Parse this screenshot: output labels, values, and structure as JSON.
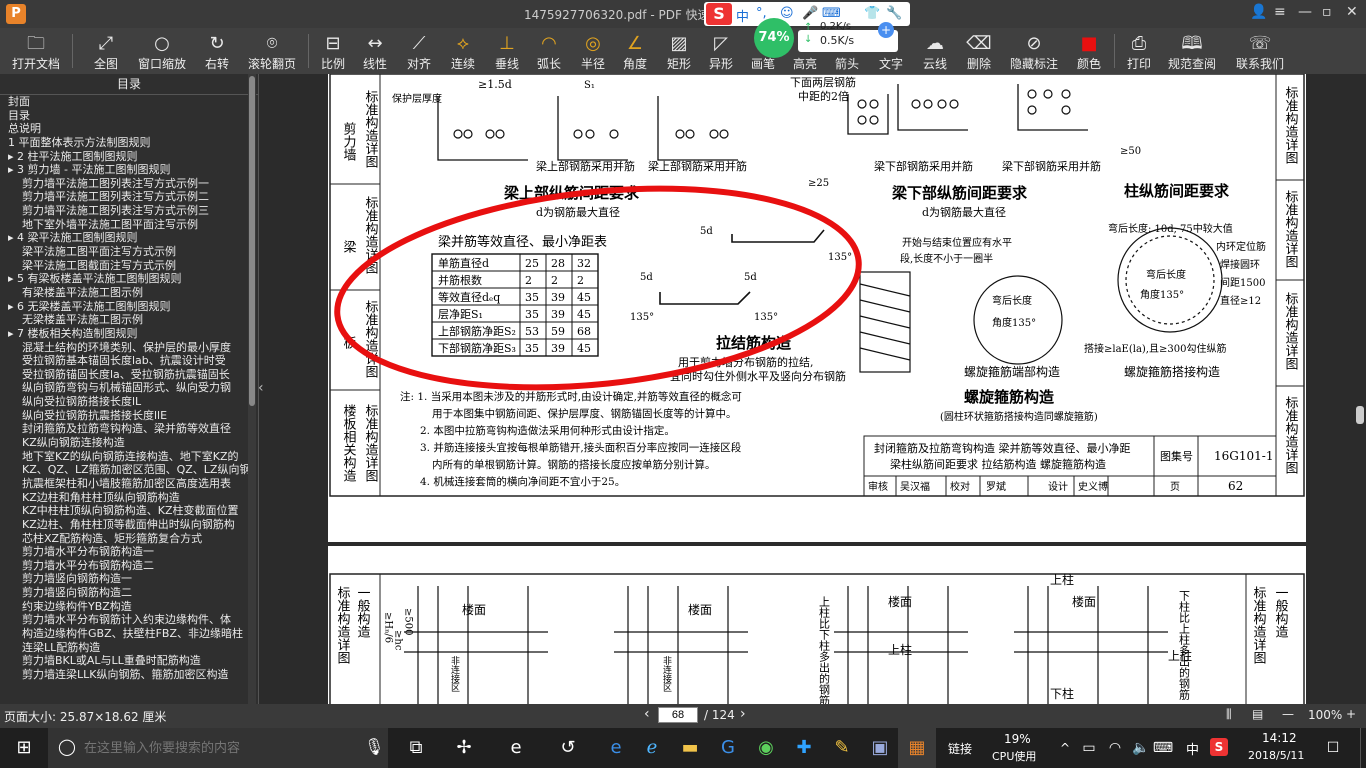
{
  "window": {
    "title": "1475927706320.pdf - PDF 快速看",
    "app_icon": "P"
  },
  "ime": {
    "logo": "S",
    "items": [
      "中",
      "°,",
      "☺",
      "🎤",
      "⌨",
      "👕",
      "🔧"
    ]
  },
  "network": {
    "percent": "74%",
    "up": "0.2K/s",
    "down": "0.5K/s"
  },
  "toolbar": [
    {
      "label": "打开文档",
      "icon": "folder-icon"
    },
    {
      "label": "全图",
      "icon": "fit-icon"
    },
    {
      "label": "窗口缩放",
      "icon": "zoom-icon"
    },
    {
      "label": "右转",
      "icon": "rotate-icon"
    },
    {
      "label": "滚轮翻页",
      "icon": "mouse-icon"
    },
    {
      "label": "比例",
      "icon": "scale-icon"
    },
    {
      "label": "线性",
      "icon": "linear-icon"
    },
    {
      "label": "对齐",
      "icon": "align-icon"
    },
    {
      "label": "连续",
      "icon": "continuous-icon"
    },
    {
      "label": "垂线",
      "icon": "perpendicular-icon"
    },
    {
      "label": "弧长",
      "icon": "arc-icon"
    },
    {
      "label": "半径",
      "icon": "radius-icon"
    },
    {
      "label": "角度",
      "icon": "angle-icon"
    },
    {
      "label": "矩形",
      "icon": "rect-icon"
    },
    {
      "label": "异形",
      "icon": "shape-icon"
    },
    {
      "label": "画笔",
      "icon": "pen-icon"
    },
    {
      "label": "高亮",
      "icon": "highlight-icon"
    },
    {
      "label": "箭头",
      "icon": "arrow-icon"
    },
    {
      "label": "文字",
      "icon": "text-icon"
    },
    {
      "label": "云线",
      "icon": "cloud-icon"
    },
    {
      "label": "删除",
      "icon": "eraser-icon"
    },
    {
      "label": "隐藏标注",
      "icon": "hide-icon"
    },
    {
      "label": "颜色",
      "icon": "color-icon"
    },
    {
      "label": "打印",
      "icon": "print-icon"
    },
    {
      "label": "规范查阅",
      "icon": "book-icon"
    },
    {
      "label": "联系我们",
      "icon": "contact-icon"
    }
  ],
  "sidebar": {
    "heading": "目录",
    "items": [
      "封面",
      "目录",
      "总说明",
      "1 平面整体表示方法制图规则",
      "▸ 2 柱平法施工图制图规则",
      "▸ 3 剪力墙 - 平法施工图制图规则",
      "剪力墙平法施工图列表注写方式示例一",
      "剪力墙平法施工图列表注写方式示例二",
      "剪力墙平法施工图列表注写方式示例三",
      "地下室外墙平法施工图平面注写示例",
      "▸ 4 梁平法施工图制图规则",
      "梁平法施工图平面注写方式示例",
      "梁平法施工图截面注写方式示例",
      "▸ 5 有梁板楼盖平法施工图制图规则",
      "有梁楼盖平法施工图示例",
      "▸ 6 无梁楼盖平法施工图制图规则",
      "无梁楼盖平法施工图示例",
      "▸ 7 楼板相关构造制图规则",
      "混凝土结构的环境类别、保护层的最小厚度",
      "受拉钢筋基本锚固长度lab、抗震设计时受",
      "受拉钢筋锚固长度la、受拉钢筋抗震锚固长",
      "纵向钢筋弯钩与机械锚固形式、纵向受力钢",
      "纵向受拉钢筋搭接长度lL",
      "纵向受拉钢筋抗震搭接长度llE",
      "封闭箍筋及拉筋弯钩构造、梁并筋等效直径",
      "KZ纵向钢筋连接构造",
      "地下室KZ的纵向钢筋连接构造、地下室KZ的",
      "KZ、QZ、LZ箍筋加密区范围、QZ、LZ纵向钢",
      "抗震框架柱和小墙肢箍筋加密区高度选用表",
      "KZ边柱和角柱柱顶纵向钢筋构造",
      "KZ中柱柱顶纵向钢筋构造、KZ柱变截面位置",
      "KZ边柱、角柱柱顶等截面伸出时纵向钢筋构",
      "芯柱XZ配筋构造、矩形箍筋复合方式",
      "剪力墙水平分布钢筋构造一",
      "剪力墙水平分布钢筋构造二",
      "剪力墙竖向钢筋构造一",
      "剪力墙竖向钢筋构造二",
      "约束边缘构件YBZ构造",
      "剪力墙水平分布钢筋计入约束边缘构件、体",
      "构造边缘构件GBZ、扶壁柱FBZ、非边缘暗柱",
      "连梁LL配筋构造",
      "剪力墙BKL或AL与LL重叠时配筋构造",
      "剪力墙连梁LLK纵向钢筋、箍筋加密区构造"
    ]
  },
  "page1": {
    "side_labels": [
      [
        "剪力墙",
        "标准构造详图"
      ],
      [
        "梁",
        "标准构造详图"
      ],
      [
        "板",
        "标准构造详图"
      ],
      [
        "楼板相关构造",
        "标准构造详图"
      ]
    ],
    "right_labels": [
      "标准构造详图",
      "标准构造详图",
      "标准构造详图",
      "标准构造详图"
    ],
    "top_labels": {
      "cover": "保护层厚度",
      "d15": "≥1.5d",
      "bar_top_1": "梁上部钢筋采用并筋",
      "bar_top_2": "梁上部钢筋采用并筋",
      "bottom_two": "下面两层钢筋",
      "mid_double": "中距的2倍",
      "bar_bot_1": "梁下部钢筋采用并筋",
      "bar_bot_2": "梁下部钢筋采用并筋",
      "d25": "≥25",
      "d50": "≥50",
      "s1": "S₁"
    },
    "section_titles": {
      "beam_top": "梁上部纵筋间距要求",
      "beam_top_sub": "d为钢筋最大直径",
      "beam_bot": "梁下部纵筋间距要求",
      "beam_bot_sub": "d为钢筋最大直径",
      "column": "柱纵筋间距要求",
      "tie": "拉结筋构造",
      "tie_note1": "用于剪力墙分布钢筋的拉结,",
      "tie_note2": "宜同时勾住外侧水平及竖向分布钢筋",
      "spiral": "螺旋箍筋构造",
      "spiral_sub": "(圆柱环状箍筋搭接构造同螺旋箍筋)",
      "spiral_end": "螺旋箍筋端部构造",
      "spiral_lap": "螺旋箍筋搭接构造",
      "hook_len": "弯后长度: 10d, 75中较大值",
      "inner_pos": "内环定位筋",
      "weld_ring": "焊接圆环",
      "spacing": "间距1500",
      "dia": "直径≥12",
      "lap_note": "搭接≥laE(la),且≥300勾住纵筋",
      "start_end": "开始与结束位置应有水平",
      "segment": "段,长度不小于一圈半",
      "hook_a": "弯后长度",
      "angle_a": "角度135°",
      "hook_b": "弯后长度",
      "angle_b": "角度135°",
      "d5": "5d",
      "a135": "135°"
    },
    "table": {
      "title": "梁并筋等效直径、最小净距表",
      "rows": [
        [
          "单筋直径d",
          "25",
          "28",
          "32"
        ],
        [
          "并筋根数",
          "2",
          "2",
          "2"
        ],
        [
          "等效直径dₑq",
          "35",
          "39",
          "45"
        ],
        [
          "层净距S₁",
          "35",
          "39",
          "45"
        ],
        [
          "上部钢筋净距S₂",
          "53",
          "59",
          "68"
        ],
        [
          "下部钢筋净距S₃",
          "35",
          "39",
          "45"
        ]
      ]
    },
    "notes": [
      "注: 1. 当采用本图未涉及的并筋形式时,由设计确定,并筋等效直径的概念可",
      "用于本图集中钢筋间距、保护层厚度、钢筋锚固长度等的计算中。",
      "2. 本图中拉筋弯钩构造做法采用何种形式由设计指定。",
      "3. 并筋连接接头宜按每根单筋错开,接头面积百分率应按同一连接区段",
      "内所有的单根钢筋计算。钢筋的搭接长度应按单筋分别计算。",
      "4. 机械连接套筒的横向净间距不宜小于25。"
    ],
    "title_block": {
      "line1": "封闭箍筋及拉筋弯钩构造 梁并筋等效直径、最小净距",
      "line2": "梁柱纵筋间距要求 拉结筋构造 螺旋箍筋构造",
      "atlas_label": "图集号",
      "atlas_no": "16G101-1",
      "review": "审核",
      "reviewer": "吴汉福",
      "check": "校对",
      "checker": "罗斌",
      "design": "设计",
      "designer": "史义博",
      "page_label": "页",
      "page_no": "62"
    }
  },
  "page2": {
    "side_label": "标准构造详图",
    "side_label2": "一般构造",
    "right_label": "标准构造详图",
    "right_label2": "一般构造",
    "floor": "楼面",
    "top_col": "上柱",
    "lower_col": "下柱",
    "upper_more": "上柱比下柱多出的钢筋",
    "lower_more": "下柱比上柱多出的钢筋",
    "he6": "≥Hₙ/6",
    "hc": "≥hc",
    "d500": "≥500",
    "conn": "非连接区"
  },
  "statusbar": {
    "page_size": "页面大小: 25.87×18.62 厘米",
    "current_page": "68",
    "total": "/ 124",
    "zoom": "100%"
  },
  "taskbar": {
    "search_placeholder": "在这里输入你要搜索的内容",
    "link_label": "链接",
    "cpu_percent": "19%",
    "cpu_label": "CPU使用",
    "ime": "中",
    "time": "14:12",
    "date": "2018/5/11"
  },
  "colors": {
    "annotation_ellipse": "#e81010",
    "accent": "#e0a320",
    "toolbar_bg": "#404040"
  }
}
